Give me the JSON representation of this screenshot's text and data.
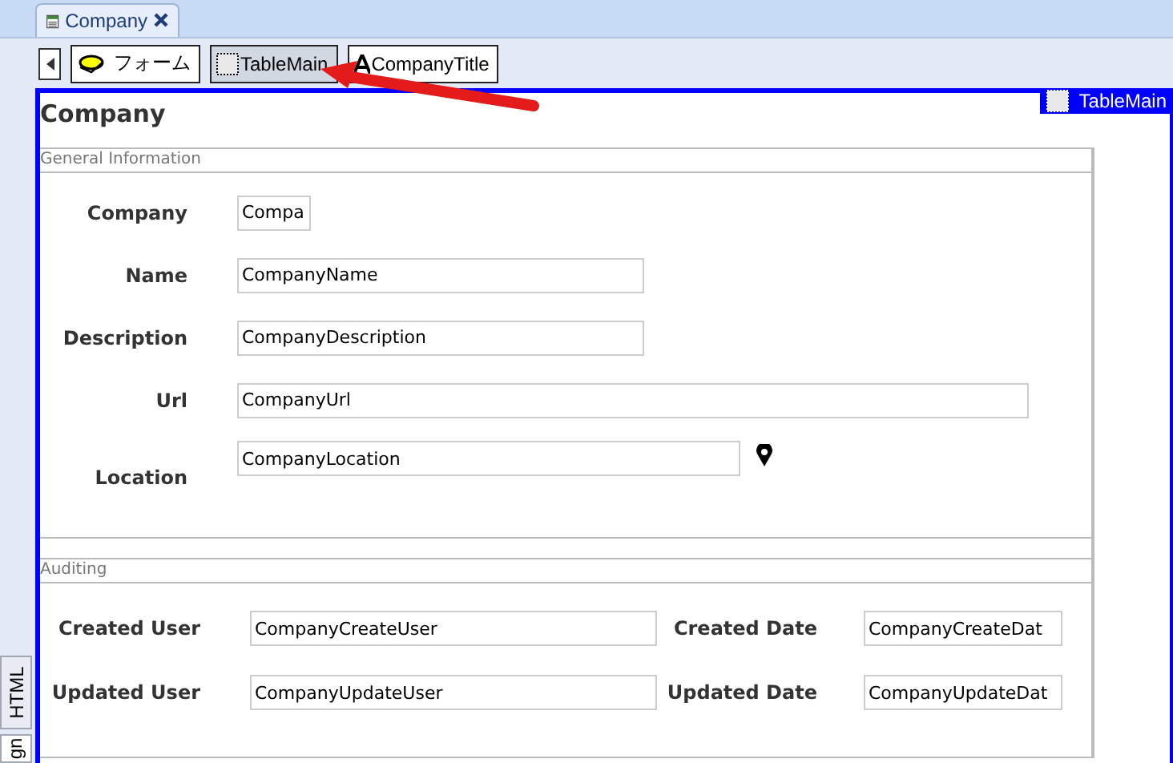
{
  "document_tab": {
    "title": "Company"
  },
  "toolbar": [
    {
      "label": "フォーム",
      "kind": "form",
      "selected": false
    },
    {
      "label": "TableMain",
      "kind": "table",
      "selected": true
    },
    {
      "label": "CompanyTitle",
      "kind": "text",
      "selected": false
    }
  ],
  "selection_label": "TableMain",
  "form_title": "Company",
  "general": {
    "legend": "General Information",
    "rows": [
      {
        "label": "Company",
        "value": "Compa",
        "pin": false
      },
      {
        "label": "Name",
        "value": "CompanyName",
        "pin": false
      },
      {
        "label": "Description",
        "value": "CompanyDescription",
        "pin": false
      },
      {
        "label": "Url",
        "value": "CompanyUrl",
        "pin": false
      },
      {
        "label": "Location",
        "value": "CompanyLocation",
        "pin": true
      }
    ]
  },
  "auditing": {
    "legend": "Auditing",
    "rows": [
      [
        {
          "label": "Created User",
          "value": "CompanyCreateUser"
        },
        {
          "label": "Created Date",
          "value": "CompanyCreateDat"
        }
      ],
      [
        {
          "label": "Updated User",
          "value": "CompanyUpdateUser"
        },
        {
          "label": "Updated Date",
          "value": "CompanyUpdateDat"
        }
      ]
    ]
  },
  "side_tabs": [
    {
      "label": "HTML",
      "selected": false
    },
    {
      "label": "gn",
      "selected": true
    }
  ]
}
